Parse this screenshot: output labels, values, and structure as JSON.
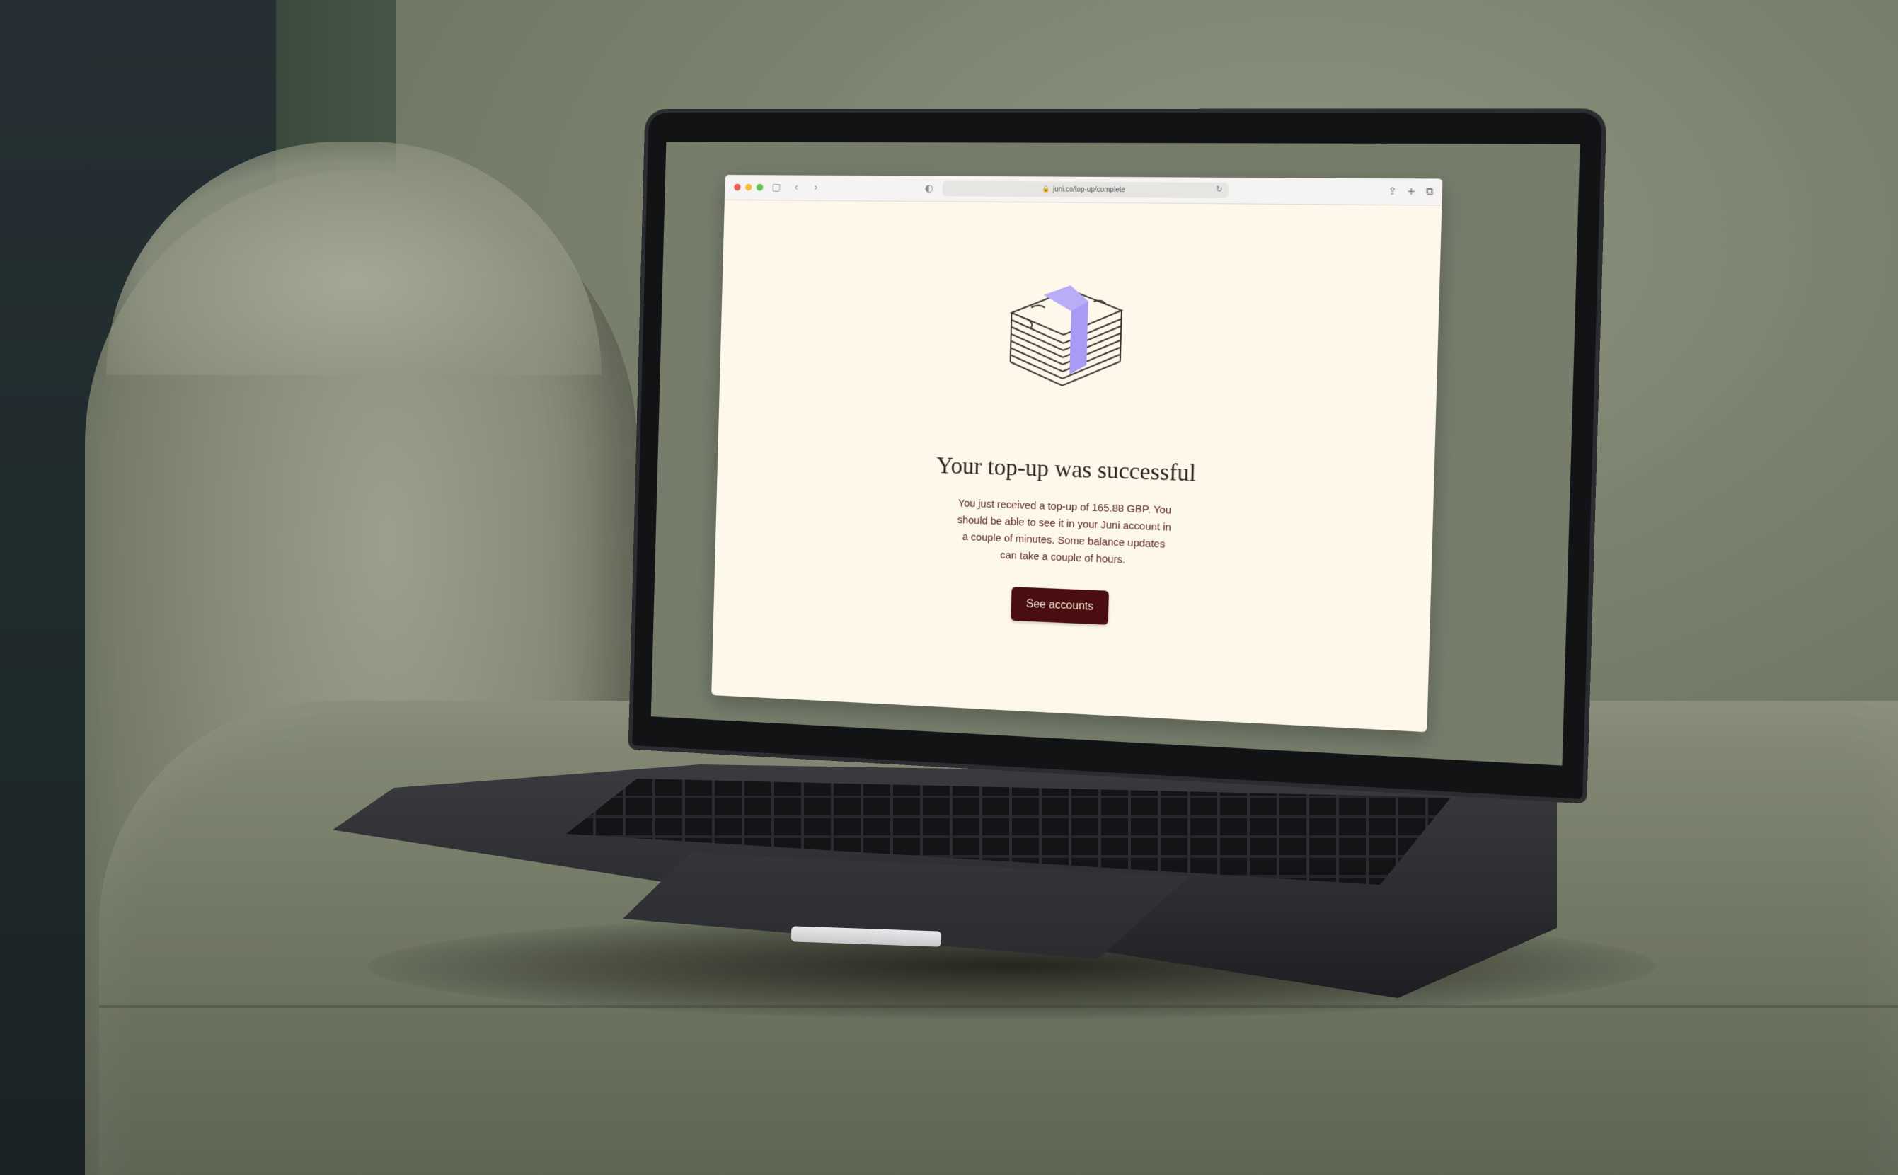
{
  "browser": {
    "url": "juni.co/top-up/complete"
  },
  "page": {
    "headline": "Your top-up was successful",
    "message": "You just received a top-up of 165.88 GBP. You should be able to see it in your Juni account in a couple of minutes. Some balance updates can take a couple of hours.",
    "cta_label": "See accounts"
  },
  "colors": {
    "page_background": "#fdf8ea",
    "cta_background": "#4a0d10",
    "cta_text": "#f6ecd9",
    "accent_band": "#a99bf5",
    "body_text": "#5a2520"
  },
  "icons": [
    "sidebar-icon",
    "back-icon",
    "forward-icon",
    "privacy-shield-icon",
    "lock-icon",
    "reload-icon",
    "share-icon",
    "new-tab-icon",
    "tabs-overview-icon",
    "money-stack-illustration"
  ]
}
